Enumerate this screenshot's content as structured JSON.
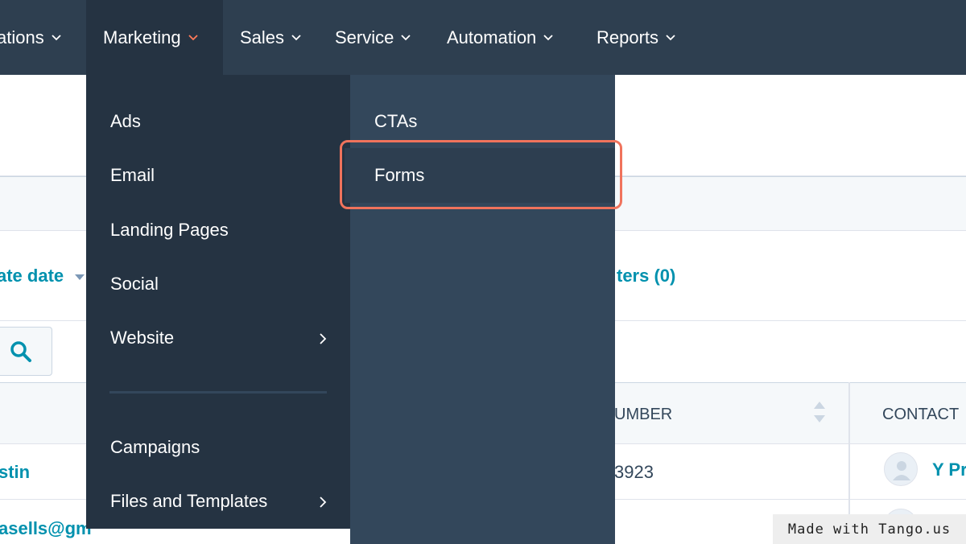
{
  "nav": {
    "items": [
      {
        "label": "ations"
      },
      {
        "label": "Marketing"
      },
      {
        "label": "Sales"
      },
      {
        "label": "Service"
      },
      {
        "label": "Automation"
      },
      {
        "label": "Reports"
      }
    ]
  },
  "background": {
    "sort_label": "ate date",
    "filters_label": "ters (0)",
    "columns": [
      "UMBER",
      "CONTACT"
    ],
    "rows": [
      {
        "name": "stin",
        "number": "3923",
        "contact": "Y Pr"
      },
      {
        "name": "asells@gm"
      }
    ]
  },
  "marketing_menu": {
    "left_items": [
      "Ads",
      "Email",
      "Landing Pages",
      "Social",
      "Website",
      "Campaigns",
      "Files and Templates"
    ],
    "right_items": [
      "CTAs",
      "Forms"
    ]
  },
  "watermark": "Made with Tango.us",
  "colors": {
    "nav_bg": "#2e3f50",
    "menu_left_bg": "#253342",
    "menu_right_bg": "#33475b",
    "highlight_border": "#f0735c",
    "link": "#0091ae"
  }
}
